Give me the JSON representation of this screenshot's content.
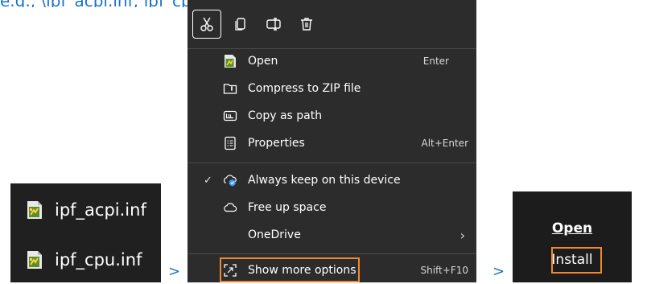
{
  "caption": "e.g., \\ipf_acpi.inf; ipf_cpu.inf",
  "files": [
    {
      "name": "ipf_acpi.inf"
    },
    {
      "name": "ipf_cpu.inf"
    }
  ],
  "arrow": ">",
  "context_menu": {
    "toolbar": [
      {
        "name": "cut-icon"
      },
      {
        "name": "copy-icon"
      },
      {
        "name": "rename-icon"
      },
      {
        "name": "delete-icon"
      }
    ],
    "items": [
      {
        "label": "Open",
        "shortcut": "Enter",
        "icon": "inf-file-icon"
      },
      {
        "label": "Compress to ZIP file",
        "shortcut": "",
        "icon": "zip-icon"
      },
      {
        "label": "Copy as path",
        "shortcut": "",
        "icon": "path-icon"
      },
      {
        "label": "Properties",
        "shortcut": "Alt+Enter",
        "icon": "properties-icon"
      },
      {
        "label": "Always keep on this device",
        "shortcut": "",
        "icon": "cloud-sync-icon",
        "checked": true
      },
      {
        "label": "Free up space",
        "shortcut": "",
        "icon": "cloud-icon"
      },
      {
        "label": "OneDrive",
        "shortcut": "",
        "icon": "",
        "submenu": true
      },
      {
        "label": "Show more options",
        "shortcut": "Shift+F10",
        "icon": "more-options-icon"
      }
    ],
    "check_glyph": "✓",
    "submenu_glyph": "›"
  },
  "classic_menu": {
    "open_label": "Open",
    "install_label": "Install"
  },
  "colors": {
    "accent": "#1a73c8",
    "highlight": "#f0892e",
    "menu_bg": "#2c2c2c"
  }
}
